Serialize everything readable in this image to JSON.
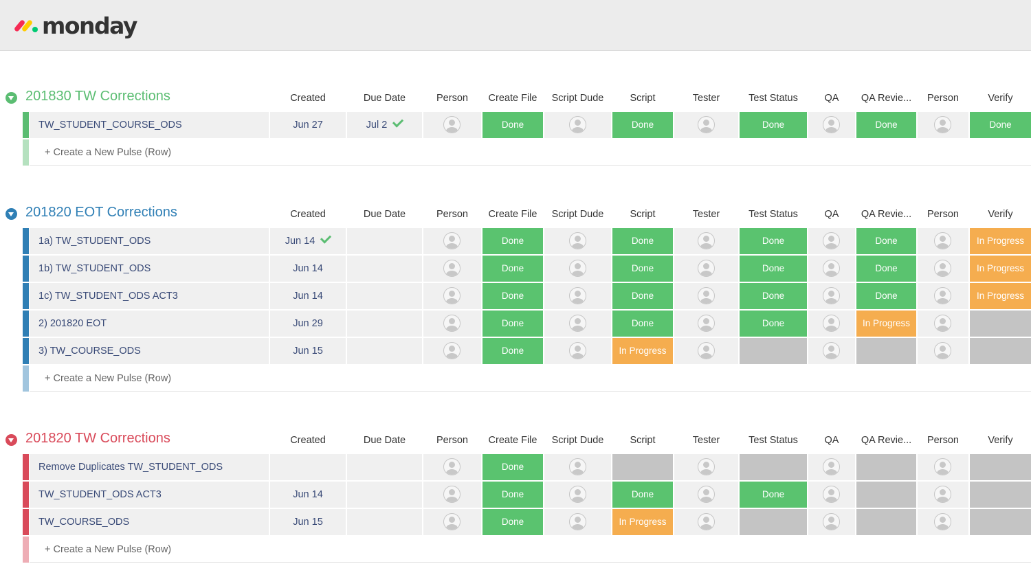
{
  "app": {
    "logo_text": "monday"
  },
  "columns": [
    "Created",
    "Due Date",
    "Person",
    "Create File",
    "Script Dude",
    "Script",
    "Tester",
    "Test Status",
    "QA",
    "QA Revie...",
    "Person",
    "Verify"
  ],
  "add_row_label": "+ Create a New Pulse (Row)",
  "colors": {
    "done": "#5ac36f",
    "in_progress": "#f5ad4f",
    "empty": "#c4c4c4",
    "group_green": "#5bbd72",
    "group_blue": "#2f7fb5",
    "group_red": "#d94a5a"
  },
  "groups": [
    {
      "title": "201830 TW Corrections",
      "color": "#5bbd72",
      "rows": [
        {
          "name": "TW_STUDENT_COURSE_ODS",
          "created": "Jun 27",
          "created_check": false,
          "due": "Jul 2",
          "due_check": true,
          "create_file": "Done",
          "script": "Done",
          "test_status": "Done",
          "qa_review": "Done",
          "verify": "Done"
        }
      ]
    },
    {
      "title": "201820 EOT Corrections",
      "color": "#2f7fb5",
      "rows": [
        {
          "name": "1a) TW_STUDENT_ODS",
          "created": "Jun 14",
          "created_check": true,
          "due": "",
          "due_check": false,
          "create_file": "Done",
          "script": "Done",
          "test_status": "Done",
          "qa_review": "Done",
          "verify": "In Progress"
        },
        {
          "name": "1b) TW_STUDENT_ODS",
          "created": "Jun 14",
          "created_check": false,
          "due": "",
          "due_check": false,
          "create_file": "Done",
          "script": "Done",
          "test_status": "Done",
          "qa_review": "Done",
          "verify": "In Progress"
        },
        {
          "name": "1c) TW_STUDENT_ODS ACT3",
          "created": "Jun 14",
          "created_check": false,
          "due": "",
          "due_check": false,
          "create_file": "Done",
          "script": "Done",
          "test_status": "Done",
          "qa_review": "Done",
          "verify": "In Progress"
        },
        {
          "name": "2) 201820 EOT",
          "created": "Jun 29",
          "created_check": false,
          "due": "",
          "due_check": false,
          "create_file": "Done",
          "script": "Done",
          "test_status": "Done",
          "qa_review": "In Progress",
          "verify": ""
        },
        {
          "name": "3) TW_COURSE_ODS",
          "created": "Jun 15",
          "created_check": false,
          "due": "",
          "due_check": false,
          "create_file": "Done",
          "script": "In Progress",
          "test_status": "",
          "qa_review": "",
          "verify": ""
        }
      ]
    },
    {
      "title": "201820 TW Corrections",
      "color": "#d94a5a",
      "rows": [
        {
          "name": "Remove Duplicates TW_STUDENT_ODS",
          "created": "",
          "created_check": false,
          "due": "",
          "due_check": false,
          "create_file": "Done",
          "script": "",
          "test_status": "",
          "qa_review": "",
          "verify": ""
        },
        {
          "name": "TW_STUDENT_ODS ACT3",
          "created": "Jun 14",
          "created_check": false,
          "due": "",
          "due_check": false,
          "create_file": "Done",
          "script": "Done",
          "test_status": "Done",
          "qa_review": "",
          "verify": ""
        },
        {
          "name": "TW_COURSE_ODS",
          "created": "Jun 15",
          "created_check": false,
          "due": "",
          "due_check": false,
          "create_file": "Done",
          "script": "In Progress",
          "test_status": "",
          "qa_review": "",
          "verify": ""
        }
      ]
    }
  ]
}
